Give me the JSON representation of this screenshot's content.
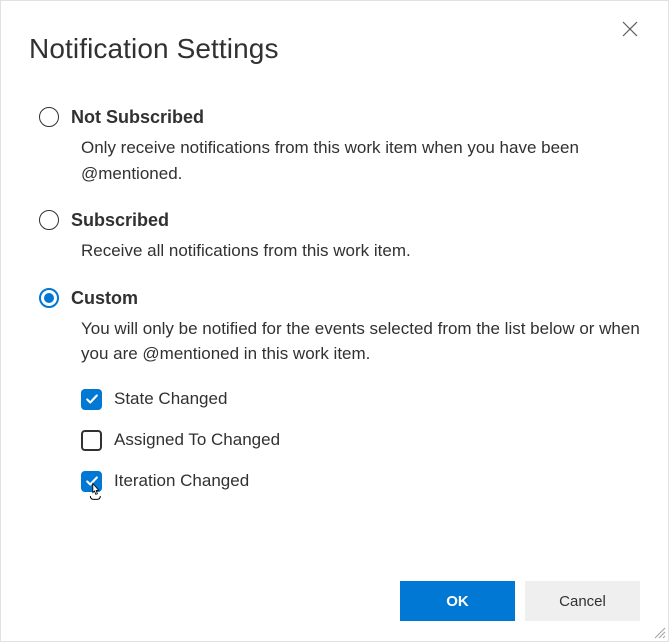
{
  "dialog": {
    "title": "Notification Settings"
  },
  "options": {
    "notSubscribed": {
      "label": "Not Subscribed",
      "desc": "Only receive notifications from this work item when you have been @mentioned.",
      "selected": false
    },
    "subscribed": {
      "label": "Subscribed",
      "desc": "Receive all notifications from this work item.",
      "selected": false
    },
    "custom": {
      "label": "Custom",
      "desc": "You will only be notified for the events selected from the list below or when you are @mentioned in this work item.",
      "selected": true,
      "checks": {
        "stateChanged": {
          "label": "State Changed",
          "checked": true
        },
        "assignedToChanged": {
          "label": "Assigned To Changed",
          "checked": false
        },
        "iterationChanged": {
          "label": "Iteration Changed",
          "checked": true
        }
      }
    }
  },
  "buttons": {
    "ok": "OK",
    "cancel": "Cancel"
  }
}
